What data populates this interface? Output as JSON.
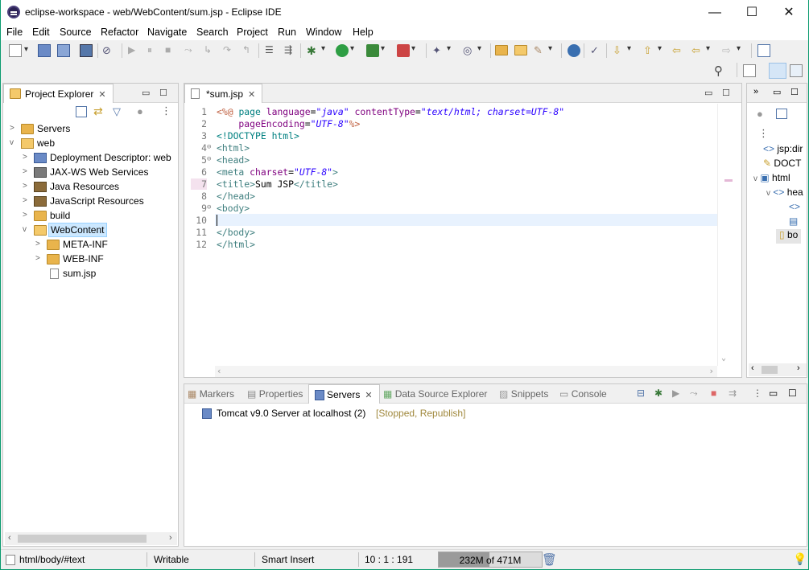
{
  "window": {
    "title": "eclipse-workspace - web/WebContent/sum.jsp - Eclipse IDE",
    "minimize": "—",
    "maximize": "☐",
    "close": "✕"
  },
  "menu": [
    "File",
    "Edit",
    "Source",
    "Refactor",
    "Navigate",
    "Search",
    "Project",
    "Run",
    "Window",
    "Help"
  ],
  "project_explorer": {
    "title": "Project Explorer",
    "tree": [
      {
        "label": "Servers",
        "type": "folder",
        "twisty": ">"
      },
      {
        "label": "web",
        "type": "project",
        "twisty": "v"
      },
      {
        "label": "Deployment Descriptor: web",
        "type": "descriptor",
        "twisty": ">"
      },
      {
        "label": "JAX-WS Web Services",
        "type": "ws",
        "twisty": ">"
      },
      {
        "label": "Java Resources",
        "type": "jres",
        "twisty": ">"
      },
      {
        "label": "JavaScript Resources",
        "type": "jsres",
        "twisty": ">"
      },
      {
        "label": "build",
        "type": "folder",
        "twisty": ">"
      },
      {
        "label": "WebContent",
        "type": "folder-open",
        "twisty": "v",
        "selected": true
      },
      {
        "label": "META-INF",
        "type": "folder",
        "twisty": ">"
      },
      {
        "label": "WEB-INF",
        "type": "folder",
        "twisty": ">"
      },
      {
        "label": "sum.jsp",
        "type": "file",
        "twisty": ""
      }
    ]
  },
  "editor": {
    "tab_label": "*sum.jsp",
    "lines": [
      {
        "n": "1",
        "fold": ""
      },
      {
        "n": "2",
        "fold": ""
      },
      {
        "n": "3",
        "fold": ""
      },
      {
        "n": "4",
        "fold": "⊖"
      },
      {
        "n": "5",
        "fold": "⊖"
      },
      {
        "n": "6",
        "fold": ""
      },
      {
        "n": "7",
        "fold": ""
      },
      {
        "n": "8",
        "fold": ""
      },
      {
        "n": "9",
        "fold": "⊖"
      },
      {
        "n": "10",
        "fold": ""
      },
      {
        "n": "11",
        "fold": ""
      },
      {
        "n": "12",
        "fold": ""
      }
    ],
    "code": {
      "l1_a": "<%@ ",
      "l1_b": "page ",
      "l1_c": "language",
      "l1_d": "=",
      "l1_e": "\"java\"",
      "l1_f": " contentType",
      "l1_g": "=",
      "l1_h": "\"text/html; charset=UTF-8\"",
      "l2_a": "    pageEncoding",
      "l2_b": "=",
      "l2_c": "\"UTF-8\"",
      "l2_d": "%>",
      "l3": "<!DOCTYPE html>",
      "l4": "<html>",
      "l5": "<head>",
      "l6_a": "<meta ",
      "l6_b": "charset",
      "l6_c": "=",
      "l6_d": "\"UTF-8\"",
      "l6_e": ">",
      "l7_a": "<title>",
      "l7_b": "Sum JSP",
      "l7_c": "</title>",
      "l8": "</head>",
      "l9": "<body>",
      "l10": "",
      "l11": "</body>",
      "l12": "</html>"
    }
  },
  "outline": {
    "items": [
      "jsp:dir",
      "DOCT",
      "html",
      "hea",
      "bo"
    ]
  },
  "bottom": {
    "tabs": [
      "Markers",
      "Properties",
      "Servers",
      "Data Source Explorer",
      "Snippets",
      "Console"
    ],
    "active_tab": "Servers",
    "server_name": "Tomcat v9.0 Server at localhost (2)",
    "server_state": "[Stopped, Republish]"
  },
  "status": {
    "path": "html/body/#text",
    "writable": "Writable",
    "insert_mode": "Smart Insert",
    "position": "10 : 1 : 191",
    "heap": "232M of 471M",
    "heap_used_fraction": 0.49
  },
  "colors": {
    "accent_border": "#0a9b6e",
    "tag": "#3f7f7f",
    "attr": "#7f007f",
    "value": "#2a00ff",
    "state": "#a0883c"
  }
}
